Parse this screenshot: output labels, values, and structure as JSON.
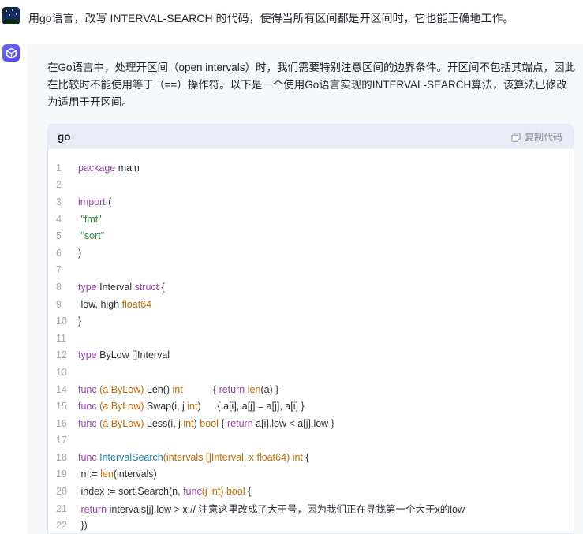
{
  "user": {
    "message": "用go语言，改写 INTERVAL-SEARCH 的代码，使得当所有区间都是开区间时，它也能正确地工作。"
  },
  "answer": {
    "intro": "在Go语言中，处理开区间（open intervals）时，我们需要特别注意区间的边界条件。开区间不包括其端点，因此在比较时不能使用等于（==）操作符。以下是一个使用Go语言实现的INTERVAL-SEARCH算法，该算法已修改为适用于开区间。",
    "code_block": {
      "language": "go",
      "copy_label": "复制代码",
      "lines": [
        {
          "n": "1",
          "parts": [
            [
              "kw",
              "package"
            ],
            [
              "tx",
              " main"
            ]
          ]
        },
        {
          "n": "2",
          "parts": []
        },
        {
          "n": "3",
          "parts": [
            [
              "kw",
              "import"
            ],
            [
              "tx",
              " ("
            ]
          ]
        },
        {
          "n": "4",
          "parts": [
            [
              "tx",
              " "
            ],
            [
              "st",
              "\"fmt\""
            ]
          ]
        },
        {
          "n": "5",
          "parts": [
            [
              "tx",
              " "
            ],
            [
              "st",
              "\"sort\""
            ]
          ]
        },
        {
          "n": "6",
          "parts": [
            [
              "tx",
              ")"
            ]
          ]
        },
        {
          "n": "7",
          "parts": []
        },
        {
          "n": "8",
          "parts": [
            [
              "kw",
              "type"
            ],
            [
              "tx",
              " Interval "
            ],
            [
              "kw",
              "struct"
            ],
            [
              "tx",
              " {"
            ]
          ]
        },
        {
          "n": "9",
          "parts": [
            [
              "tx",
              " low, high "
            ],
            [
              "ty",
              "float64"
            ]
          ]
        },
        {
          "n": "10",
          "parts": [
            [
              "tx",
              "}"
            ]
          ]
        },
        {
          "n": "11",
          "parts": []
        },
        {
          "n": "12",
          "parts": [
            [
              "kw",
              "type"
            ],
            [
              "tx",
              " ByLow []Interval"
            ]
          ]
        },
        {
          "n": "13",
          "parts": []
        },
        {
          "n": "14",
          "parts": [
            [
              "kw",
              "func"
            ],
            [
              "ty",
              " (a ByLow)"
            ],
            [
              "tx",
              " Len() "
            ],
            [
              "ty",
              "int"
            ],
            [
              "tx",
              "           { "
            ],
            [
              "kw",
              "return"
            ],
            [
              "tx",
              " "
            ],
            [
              "ty",
              "len"
            ],
            [
              "tx",
              "(a) }"
            ]
          ]
        },
        {
          "n": "15",
          "parts": [
            [
              "kw",
              "func"
            ],
            [
              "ty",
              " (a ByLow)"
            ],
            [
              "tx",
              " Swap(i, j "
            ],
            [
              "ty",
              "int"
            ],
            [
              "tx",
              ")      { a[i], a[j] = a[j], a[i] }"
            ]
          ]
        },
        {
          "n": "16",
          "parts": [
            [
              "kw",
              "func"
            ],
            [
              "ty",
              " (a ByLow)"
            ],
            [
              "tx",
              " Less(i, j "
            ],
            [
              "ty",
              "int"
            ],
            [
              "tx",
              ") "
            ],
            [
              "ty",
              "bool"
            ],
            [
              "tx",
              " { "
            ],
            [
              "kw",
              "return"
            ],
            [
              "tx",
              " a[i].low < a[j].low }"
            ]
          ]
        },
        {
          "n": "17",
          "parts": []
        },
        {
          "n": "18",
          "parts": [
            [
              "kw",
              "func"
            ],
            [
              "tx",
              " "
            ],
            [
              "fn",
              "IntervalSearch"
            ],
            [
              "ty",
              "(intervals []Interval, x float64)"
            ],
            [
              "tx",
              " "
            ],
            [
              "ty",
              "int"
            ],
            [
              "tx",
              " {"
            ]
          ]
        },
        {
          "n": "19",
          "parts": [
            [
              "tx",
              " n := "
            ],
            [
              "ty",
              "len"
            ],
            [
              "tx",
              "(intervals)"
            ]
          ]
        },
        {
          "n": "20",
          "parts": [
            [
              "tx",
              " index := sort.Search(n, "
            ],
            [
              "kw",
              "func"
            ],
            [
              "ty",
              "(j int)"
            ],
            [
              "tx",
              " "
            ],
            [
              "ty",
              "bool"
            ],
            [
              "tx",
              " {"
            ]
          ]
        },
        {
          "n": "21",
          "parts": [
            [
              "tx",
              " "
            ],
            [
              "kw",
              "return"
            ],
            [
              "tx",
              " intervals[j].low > x // 注意这里改成了大于号，因为我们正在寻找第一个大于x的low"
            ]
          ]
        },
        {
          "n": "22",
          "parts": [
            [
              "tx",
              " })"
            ]
          ]
        }
      ]
    }
  }
}
